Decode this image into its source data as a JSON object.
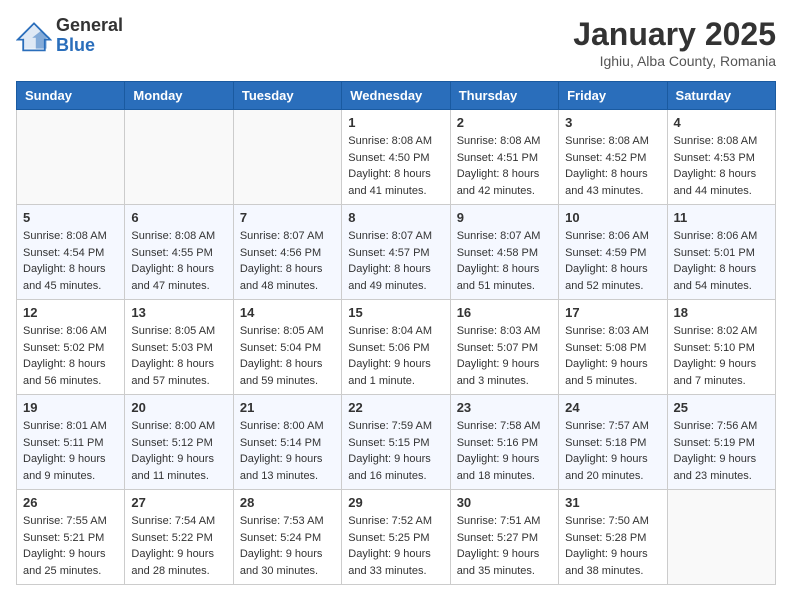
{
  "logo": {
    "general": "General",
    "blue": "Blue"
  },
  "header": {
    "month": "January 2025",
    "location": "Ighiu, Alba County, Romania"
  },
  "weekdays": [
    "Sunday",
    "Monday",
    "Tuesday",
    "Wednesday",
    "Thursday",
    "Friday",
    "Saturday"
  ],
  "weeks": [
    [
      {
        "day": "",
        "info": ""
      },
      {
        "day": "",
        "info": ""
      },
      {
        "day": "",
        "info": ""
      },
      {
        "day": "1",
        "info": "Sunrise: 8:08 AM\nSunset: 4:50 PM\nDaylight: 8 hours and 41 minutes."
      },
      {
        "day": "2",
        "info": "Sunrise: 8:08 AM\nSunset: 4:51 PM\nDaylight: 8 hours and 42 minutes."
      },
      {
        "day": "3",
        "info": "Sunrise: 8:08 AM\nSunset: 4:52 PM\nDaylight: 8 hours and 43 minutes."
      },
      {
        "day": "4",
        "info": "Sunrise: 8:08 AM\nSunset: 4:53 PM\nDaylight: 8 hours and 44 minutes."
      }
    ],
    [
      {
        "day": "5",
        "info": "Sunrise: 8:08 AM\nSunset: 4:54 PM\nDaylight: 8 hours and 45 minutes."
      },
      {
        "day": "6",
        "info": "Sunrise: 8:08 AM\nSunset: 4:55 PM\nDaylight: 8 hours and 47 minutes."
      },
      {
        "day": "7",
        "info": "Sunrise: 8:07 AM\nSunset: 4:56 PM\nDaylight: 8 hours and 48 minutes."
      },
      {
        "day": "8",
        "info": "Sunrise: 8:07 AM\nSunset: 4:57 PM\nDaylight: 8 hours and 49 minutes."
      },
      {
        "day": "9",
        "info": "Sunrise: 8:07 AM\nSunset: 4:58 PM\nDaylight: 8 hours and 51 minutes."
      },
      {
        "day": "10",
        "info": "Sunrise: 8:06 AM\nSunset: 4:59 PM\nDaylight: 8 hours and 52 minutes."
      },
      {
        "day": "11",
        "info": "Sunrise: 8:06 AM\nSunset: 5:01 PM\nDaylight: 8 hours and 54 minutes."
      }
    ],
    [
      {
        "day": "12",
        "info": "Sunrise: 8:06 AM\nSunset: 5:02 PM\nDaylight: 8 hours and 56 minutes."
      },
      {
        "day": "13",
        "info": "Sunrise: 8:05 AM\nSunset: 5:03 PM\nDaylight: 8 hours and 57 minutes."
      },
      {
        "day": "14",
        "info": "Sunrise: 8:05 AM\nSunset: 5:04 PM\nDaylight: 8 hours and 59 minutes."
      },
      {
        "day": "15",
        "info": "Sunrise: 8:04 AM\nSunset: 5:06 PM\nDaylight: 9 hours and 1 minute."
      },
      {
        "day": "16",
        "info": "Sunrise: 8:03 AM\nSunset: 5:07 PM\nDaylight: 9 hours and 3 minutes."
      },
      {
        "day": "17",
        "info": "Sunrise: 8:03 AM\nSunset: 5:08 PM\nDaylight: 9 hours and 5 minutes."
      },
      {
        "day": "18",
        "info": "Sunrise: 8:02 AM\nSunset: 5:10 PM\nDaylight: 9 hours and 7 minutes."
      }
    ],
    [
      {
        "day": "19",
        "info": "Sunrise: 8:01 AM\nSunset: 5:11 PM\nDaylight: 9 hours and 9 minutes."
      },
      {
        "day": "20",
        "info": "Sunrise: 8:00 AM\nSunset: 5:12 PM\nDaylight: 9 hours and 11 minutes."
      },
      {
        "day": "21",
        "info": "Sunrise: 8:00 AM\nSunset: 5:14 PM\nDaylight: 9 hours and 13 minutes."
      },
      {
        "day": "22",
        "info": "Sunrise: 7:59 AM\nSunset: 5:15 PM\nDaylight: 9 hours and 16 minutes."
      },
      {
        "day": "23",
        "info": "Sunrise: 7:58 AM\nSunset: 5:16 PM\nDaylight: 9 hours and 18 minutes."
      },
      {
        "day": "24",
        "info": "Sunrise: 7:57 AM\nSunset: 5:18 PM\nDaylight: 9 hours and 20 minutes."
      },
      {
        "day": "25",
        "info": "Sunrise: 7:56 AM\nSunset: 5:19 PM\nDaylight: 9 hours and 23 minutes."
      }
    ],
    [
      {
        "day": "26",
        "info": "Sunrise: 7:55 AM\nSunset: 5:21 PM\nDaylight: 9 hours and 25 minutes."
      },
      {
        "day": "27",
        "info": "Sunrise: 7:54 AM\nSunset: 5:22 PM\nDaylight: 9 hours and 28 minutes."
      },
      {
        "day": "28",
        "info": "Sunrise: 7:53 AM\nSunset: 5:24 PM\nDaylight: 9 hours and 30 minutes."
      },
      {
        "day": "29",
        "info": "Sunrise: 7:52 AM\nSunset: 5:25 PM\nDaylight: 9 hours and 33 minutes."
      },
      {
        "day": "30",
        "info": "Sunrise: 7:51 AM\nSunset: 5:27 PM\nDaylight: 9 hours and 35 minutes."
      },
      {
        "day": "31",
        "info": "Sunrise: 7:50 AM\nSunset: 5:28 PM\nDaylight: 9 hours and 38 minutes."
      },
      {
        "day": "",
        "info": ""
      }
    ]
  ]
}
